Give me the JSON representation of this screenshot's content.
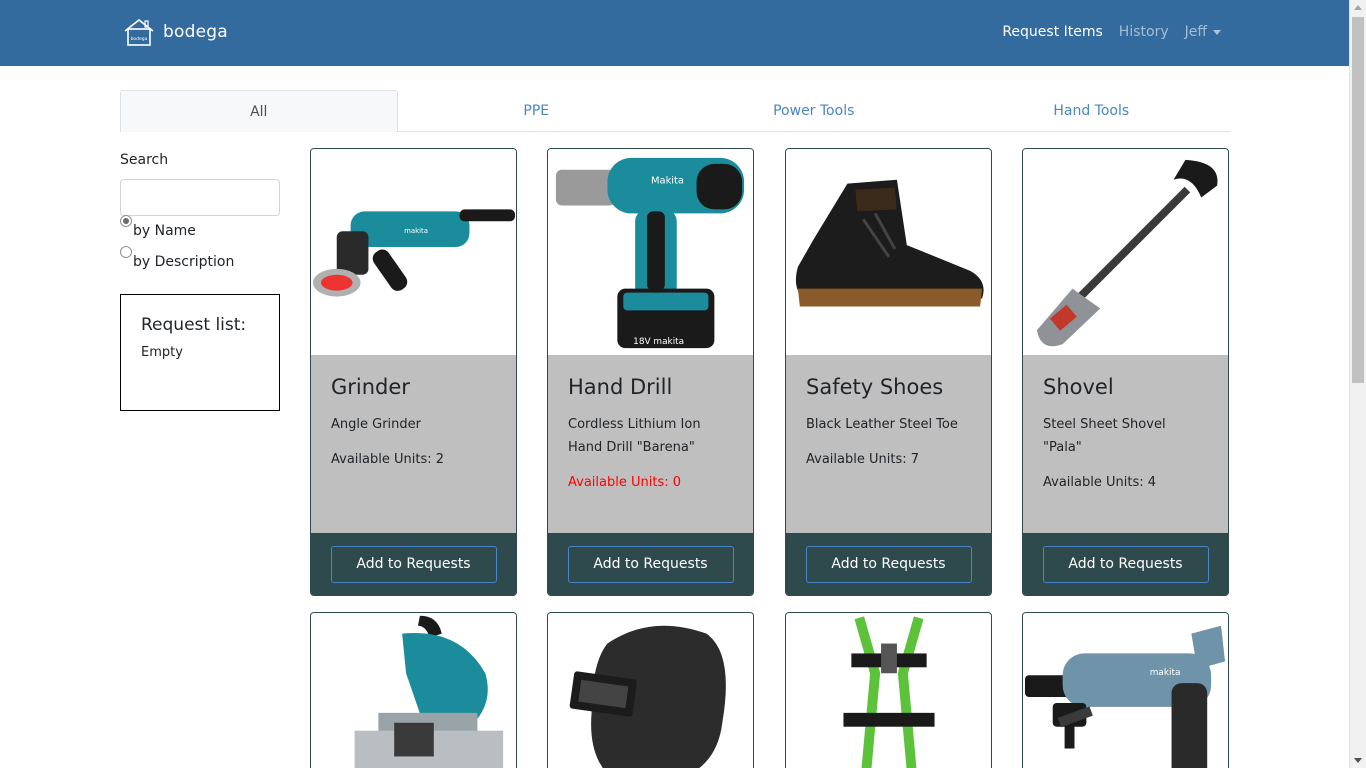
{
  "brand": {
    "name": "bodega",
    "logo_icon": "house-logo-icon",
    "logo_text": "bodega"
  },
  "nav": {
    "items": [
      {
        "label": "Request Items",
        "active": true
      },
      {
        "label": "History",
        "active": false
      }
    ],
    "user": {
      "label": "Jeff",
      "icon": "caret-down-icon"
    }
  },
  "tabs": [
    {
      "label": "All",
      "active": true
    },
    {
      "label": "PPE",
      "active": false
    },
    {
      "label": "Power Tools",
      "active": false
    },
    {
      "label": "Hand Tools",
      "active": false
    }
  ],
  "sidebar": {
    "search_label": "Search",
    "search_value": "",
    "radios": [
      {
        "label": "by Name",
        "checked": true
      },
      {
        "label": "by Description",
        "checked": false
      }
    ],
    "request_list": {
      "title": "Request list:",
      "status": "Empty"
    }
  },
  "products": [
    {
      "name": "Grinder",
      "description": "Angle Grinder",
      "units": "Available Units: 2",
      "out_of_stock": false,
      "image_icon": "angle-grinder-image",
      "button": "Add to Requests"
    },
    {
      "name": "Hand Drill",
      "description": "Cordless Lithium Ion Hand Drill \"Barena\"",
      "units": "Available Units: 0",
      "out_of_stock": true,
      "image_icon": "cordless-drill-image",
      "button": "Add to Requests"
    },
    {
      "name": "Safety Shoes",
      "description": "Black Leather Steel Toe",
      "units": "Available Units: 7",
      "out_of_stock": false,
      "image_icon": "safety-boot-image",
      "button": "Add to Requests"
    },
    {
      "name": "Shovel",
      "description": "Steel Sheet Shovel \"Pala\"",
      "units": "Available Units: 4",
      "out_of_stock": false,
      "image_icon": "shovel-image",
      "button": "Add to Requests"
    }
  ],
  "products_row2": [
    {
      "image_icon": "chop-saw-image"
    },
    {
      "image_icon": "welding-helmet-image"
    },
    {
      "image_icon": "safety-harness-image"
    },
    {
      "image_icon": "rotary-hammer-image"
    }
  ],
  "colors": {
    "navbar": "#336b9f",
    "card_footer": "#2f4a4d",
    "card_body": "#bfbfbf",
    "link": "#4a86c5",
    "out_of_stock": "#ff0000"
  }
}
